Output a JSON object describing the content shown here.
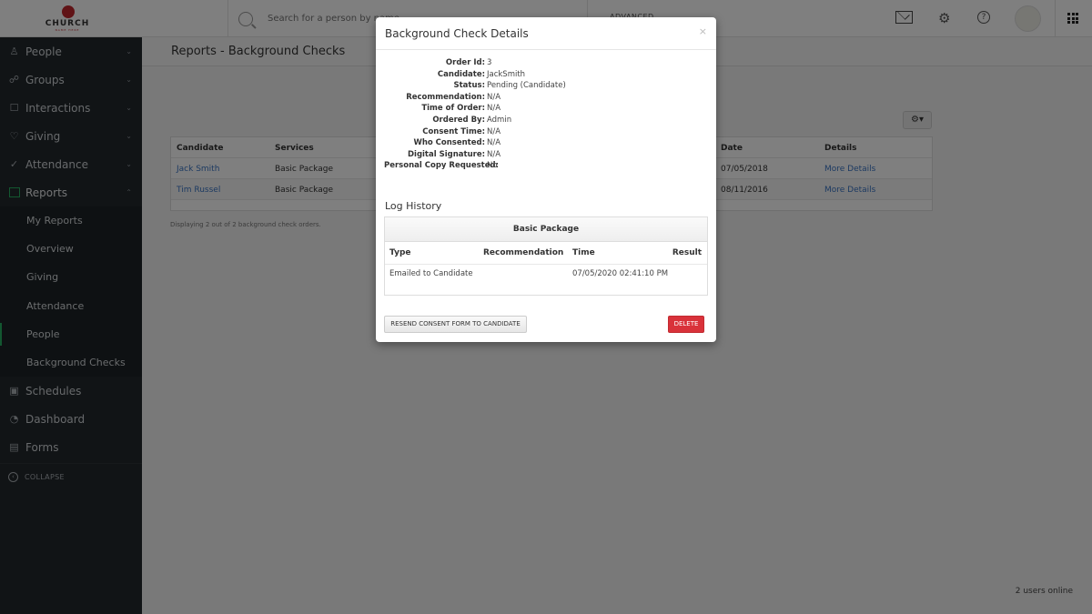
{
  "app": {
    "logo_text": "CHURCH",
    "logo_sub": "NAME HERE",
    "brand_color": "#c0272d",
    "accent_color": "#27ae60"
  },
  "topbar": {
    "search_placeholder": "Search for a person by name",
    "advanced_label": "ADVANCED",
    "icons": [
      "mail-icon",
      "gear-icon",
      "help-icon",
      "avatar",
      "apps-grid-icon"
    ],
    "gear_glyph": "⚙",
    "help_glyph": "?"
  },
  "sidebar": {
    "items": [
      {
        "label": "People",
        "icon": "person-icon",
        "glyph": "♙",
        "chevron": "⌄"
      },
      {
        "label": "Groups",
        "icon": "groups-icon",
        "glyph": "☍",
        "chevron": "⌄"
      },
      {
        "label": "Interactions",
        "icon": "chat-icon",
        "glyph": "☐",
        "chevron": "⌄"
      },
      {
        "label": "Giving",
        "icon": "heart-icon",
        "glyph": "♡",
        "chevron": "⌄"
      },
      {
        "label": "Attendance",
        "icon": "check-circle-icon",
        "glyph": "✓",
        "chevron": "⌄"
      },
      {
        "label": "Reports",
        "icon": "chart-icon",
        "glyph": "",
        "chevron": "⌃"
      }
    ],
    "sub_items": [
      {
        "label": "My Reports"
      },
      {
        "label": "Overview"
      },
      {
        "label": "Giving"
      },
      {
        "label": "Attendance"
      },
      {
        "label": "People"
      },
      {
        "label": "Background Checks"
      }
    ],
    "bottom_items": [
      {
        "label": "Schedules",
        "icon": "schedule-icon",
        "glyph": "▣"
      },
      {
        "label": "Dashboard",
        "icon": "dashboard-icon",
        "glyph": "◔"
      },
      {
        "label": "Forms",
        "icon": "forms-icon",
        "glyph": "▤"
      }
    ],
    "collapse_label": "COLLAPSE",
    "collapse_glyph": "‹"
  },
  "main": {
    "page_title": "Reports - Background Checks",
    "settings_glyph": "⚙▾",
    "table": {
      "headers": [
        "Candidate",
        "Services",
        "Date",
        "Details"
      ],
      "rows": [
        {
          "candidate": "Jack Smith",
          "services": "Basic Package",
          "date": "07/05/2018",
          "details": "More Details"
        },
        {
          "candidate": "Tim Russel",
          "services": "Basic Package",
          "date": "08/11/2016",
          "details": "More Details"
        }
      ]
    },
    "footer_note": "Displaying 2 out of 2 background check orders.",
    "users_online": "2 users online"
  },
  "modal": {
    "title": "Background Check Details",
    "close_glyph": "×",
    "details": [
      {
        "label": "Order Id:",
        "value": "3"
      },
      {
        "label": "Candidate:",
        "value": "JackSmith"
      },
      {
        "label": "Status:",
        "value": "Pending (Candidate)"
      },
      {
        "label": "Recommendation:",
        "value": "N/A"
      },
      {
        "label": "Time of Order:",
        "value": "N/A"
      },
      {
        "label": "Ordered By:",
        "value": "Admin"
      },
      {
        "label": "Consent Time:",
        "value": "N/A"
      },
      {
        "label": "Who Consented:",
        "value": "N/A"
      },
      {
        "label": "Digital Signature:",
        "value": "N/A"
      },
      {
        "label": "Personal Copy Requested:",
        "value": "No"
      }
    ],
    "log_history": {
      "title": "Log History",
      "package": "Basic Package",
      "headers": [
        "Type",
        "Recommendation",
        "Time",
        "Result"
      ],
      "rows": [
        {
          "type": "Emailed to Candidate",
          "recommendation": "",
          "time": "07/05/2020 02:41:10 PM",
          "result": ""
        }
      ]
    },
    "resend_label": "RESEND CONSENT FORM TO CANDIDATE",
    "delete_label": "DELETE",
    "delete_color": "#d9323a"
  }
}
